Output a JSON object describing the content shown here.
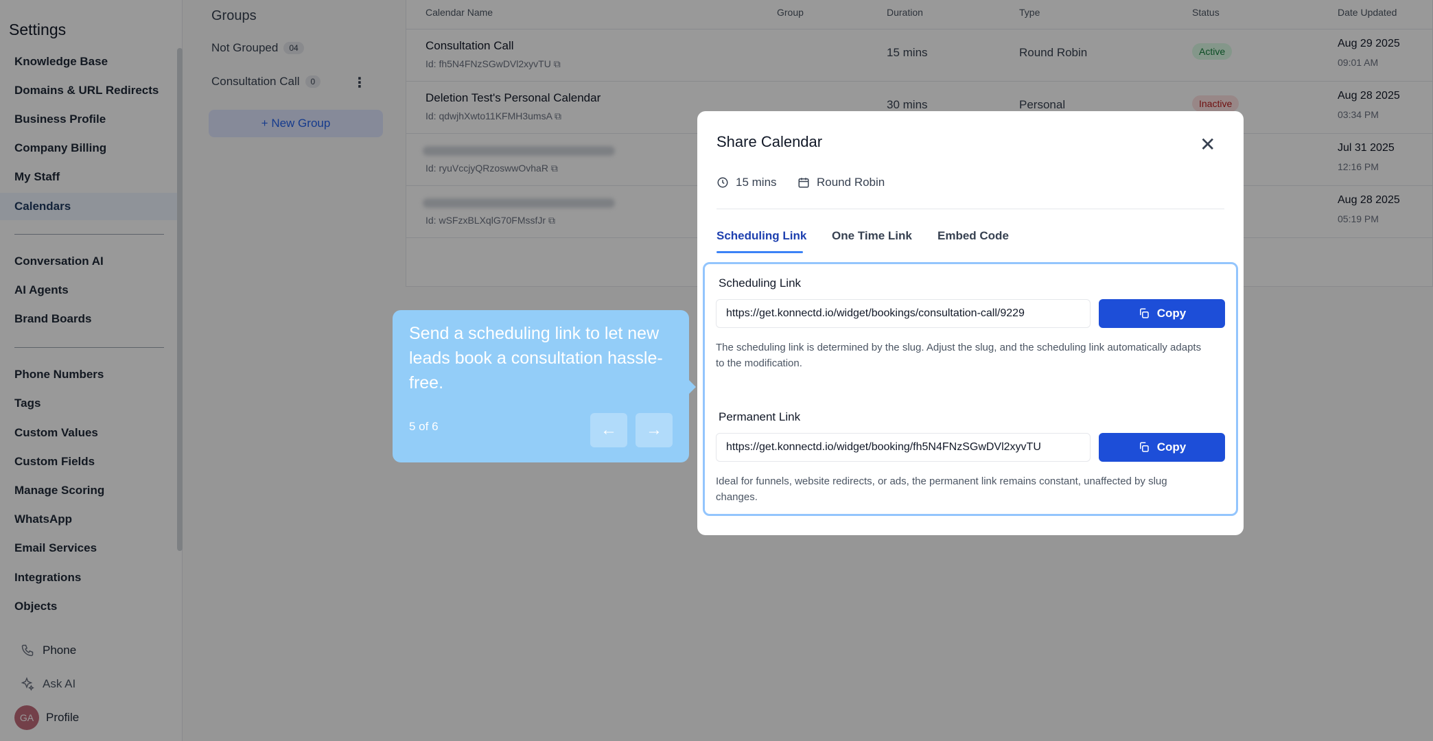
{
  "sidebar": {
    "title": "Settings",
    "items": [
      "Knowledge Base",
      "Domains & URL Redirects",
      "Business Profile",
      "Company Billing",
      "My Staff",
      "Calendars"
    ],
    "items2": [
      "Conversation AI",
      "AI Agents",
      "Brand Boards"
    ],
    "items3": [
      "Phone Numbers",
      "Tags",
      "Custom Values",
      "Custom Fields",
      "Manage Scoring",
      "WhatsApp",
      "Email Services",
      "Integrations",
      "Objects"
    ],
    "bottom": {
      "phone": "Phone",
      "ask_ai": "Ask AI",
      "profile": "Profile",
      "avatar_initials": "GA"
    }
  },
  "groups": {
    "title": "Groups",
    "items": [
      {
        "label": "Not Grouped",
        "count": "04"
      },
      {
        "label": "Consultation Call",
        "count": "0"
      }
    ],
    "new_group": "+ New Group"
  },
  "table": {
    "headers": [
      "Calendar Name",
      "Group",
      "Duration",
      "Type",
      "Status",
      "Date Updated"
    ],
    "rows": [
      {
        "name": "Consultation Call",
        "id": "Id: fh5N4FNzSGwDVl2xyvTU",
        "duration": "15 mins",
        "type": "Round Robin",
        "status": "Active",
        "date": "Aug 29 2025",
        "time": "09:01 AM"
      },
      {
        "name": "Deletion Test's Personal Calendar",
        "id": "Id: qdwjhXwto11KFMH3umsA",
        "duration": "30 mins",
        "type": "Personal",
        "status": "Inactive",
        "date": "Aug 28 2025",
        "time": "03:34 PM"
      },
      {
        "name": "",
        "id": "Id: ryuVccjyQRzoswwOvhaR",
        "duration": "",
        "type": "",
        "status": "",
        "date": "Jul 31 2025",
        "time": "12:16 PM"
      },
      {
        "name": "",
        "id": "Id: wSFzxBLXqlG70FMssfJr",
        "duration": "",
        "type": "",
        "status": "",
        "date": "Aug 28 2025",
        "time": "05:19 PM"
      }
    ]
  },
  "tour": {
    "text": "Send a scheduling link to let new leads book a consultation hassle-free.",
    "step": "5 of 6",
    "prev": "←",
    "next": "→"
  },
  "modal": {
    "title": "Share Calendar",
    "close": "✕",
    "duration": "15 mins",
    "type": "Round Robin",
    "tabs": [
      "Scheduling Link",
      "One Time Link",
      "Embed Code"
    ],
    "scheduling": {
      "label": "Scheduling Link",
      "url": "https://get.konnectd.io/widget/bookings/consultation-call/9229",
      "copy": "Copy",
      "help": "The scheduling link is determined by the slug. Adjust the slug, and the scheduling link automatically adapts to the modification."
    },
    "permanent": {
      "label": "Permanent Link",
      "url": "https://get.konnectd.io/widget/booking/fh5N4FNzSGwDVl2xyvTU",
      "copy": "Copy",
      "help": "Ideal for funnels, website redirects, or ads, the permanent link remains constant, unaffected by slug changes."
    }
  },
  "colors": {
    "accent": "#1d4ed8",
    "tour_bg": "#93cdf8",
    "active_badge": "#15803d",
    "inactive_badge": "#b91c1c"
  }
}
